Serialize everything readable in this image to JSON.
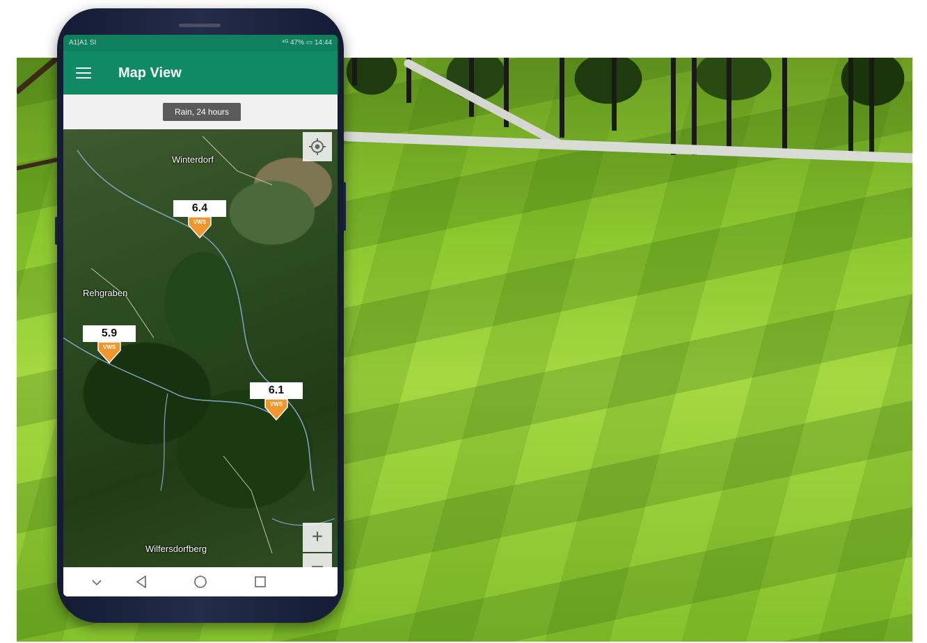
{
  "statusbar": {
    "carrier": "A1|A1 SI",
    "right_info": "⁴ᴳ 47% ▭ 14:44"
  },
  "appbar": {
    "title": "Map View",
    "menu_icon": "hamburger-menu-icon"
  },
  "filter": {
    "label": "Rain, 24 hours"
  },
  "map": {
    "places": [
      "Winterdorf",
      "Rehgraben",
      "Wilfersdorfberg"
    ],
    "markers": [
      {
        "value": "6.4",
        "badge": "VWS"
      },
      {
        "value": "5.9",
        "badge": "VWS"
      },
      {
        "value": "6.1",
        "badge": "VWS"
      }
    ],
    "marker_color": "#f0962c",
    "controls": {
      "locate_icon": "crosshair-locate-icon",
      "zoom_in": "+",
      "zoom_out_icon": "minus-icon"
    }
  },
  "navbar": {
    "icons": [
      "chevron-down-icon",
      "back-triangle-icon",
      "home-circle-icon",
      "recents-square-icon"
    ]
  },
  "colors": {
    "appbar": "#0f8a63",
    "statusbar": "#0f7f5c"
  }
}
